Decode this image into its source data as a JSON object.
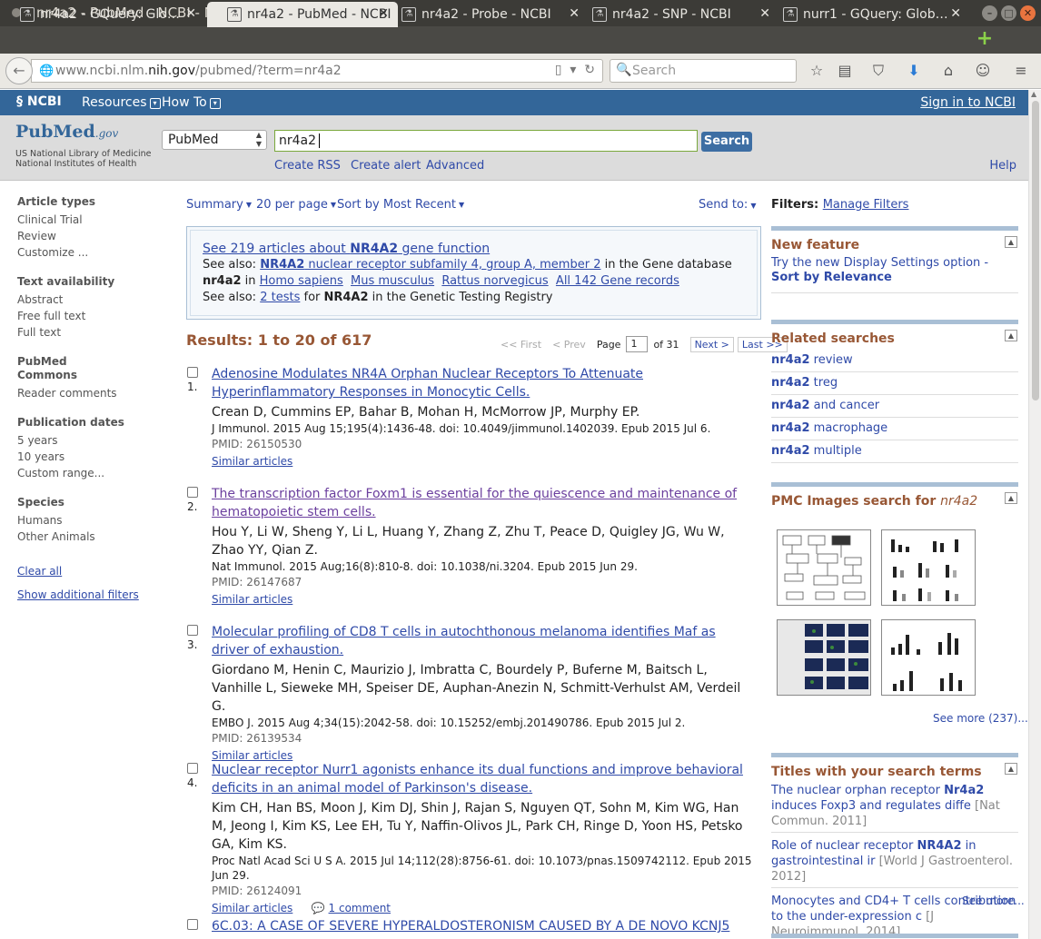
{
  "window": {
    "title": "nr4a2 - PubMed - NCBI - Mozilla Firefox"
  },
  "tabs": [
    {
      "label": "nr4a2 - GQuery: Glo…"
    },
    {
      "label": "nr4a2 - PubMed - NCBI"
    },
    {
      "label": "nr4a2 - Probe - NCBI"
    },
    {
      "label": "nr4a2 - SNP - NCBI"
    },
    {
      "label": "nurr1 - GQuery: Glob…"
    }
  ],
  "url": {
    "prefix": "www.ncbi.nlm.",
    "host": "nih.gov",
    "path": "/pubmed/?term=nr4a2"
  },
  "browser_search": {
    "placeholder": "Search"
  },
  "ncbi": {
    "logo": "NCBI",
    "resources": "Resources",
    "howto": "How To",
    "signin": "Sign in to NCBI"
  },
  "pubmed": {
    "logo_pub": "Pub",
    "logo_med": "Med",
    "logo_gov": ".gov",
    "sub1": "US National Library of Medicine",
    "sub2": "National Institutes of Health",
    "db": "PubMed",
    "query": "nr4a2",
    "search_btn": "Search",
    "create_rss": "Create RSS",
    "create_alert": "Create alert",
    "advanced": "Advanced",
    "help": "Help"
  },
  "leftnav": {
    "article_types": "Article types",
    "clinical_trial": "Clinical Trial",
    "review": "Review",
    "customize": "Customize ...",
    "text_availability": "Text availability",
    "abstract": "Abstract",
    "free_full_text": "Free full text",
    "full_text": "Full text",
    "pubmed_commons": "PubMed Commons",
    "reader_comments": "Reader comments",
    "pub_dates": "Publication dates",
    "five_years": "5 years",
    "ten_years": "10 years",
    "custom_range": "Custom range...",
    "species": "Species",
    "humans": "Humans",
    "other_animals": "Other Animals",
    "clear_all": "Clear all",
    "show_filters": "Show additional filters"
  },
  "controls": {
    "summary": "Summary",
    "per_page": "20 per page",
    "sort": "Sort by Most Recent",
    "send_to": "Send to:"
  },
  "see_all": {
    "line1_a": "See 219 articles about ",
    "line1_b": "NR4A2",
    "line1_c": " gene function",
    "see_also": "See also: ",
    "gene_link_b": "NR4A2",
    "gene_link": " nuclear receptor subfamily 4, group A, member 2",
    "gene_db": " in the Gene database",
    "nr4a2": "nr4a2",
    "in": " in ",
    "homo": "Homo sapiens",
    "mus": "Mus musculus",
    "rattus": "Rattus norvegicus",
    "all142": "All 142 Gene records",
    "tests": "2 tests",
    "for": " for ",
    "nr4a2_caps": "NR4A2",
    "gtr": " in the Genetic Testing Registry"
  },
  "results": {
    "header": "Results: 1 to 20 of 617"
  },
  "pager": {
    "first": "<< First",
    "prev": "< Prev",
    "page": "Page",
    "page_num": "1",
    "of": "of 31",
    "next": "Next >",
    "last": "Last >>"
  },
  "articles": [
    {
      "num": "1.",
      "title": "Adenosine Modulates NR4A Orphan Nuclear Receptors To Attenuate Hyperinflammatory Responses in Monocytic Cells.",
      "authors": "Crean D, Cummins EP, Bahar B, Mohan H, McMorrow JP, Murphy EP.",
      "journal": "J Immunol. 2015 Aug 15;195(4):1436-48. doi: 10.4049/jimmunol.1402039. Epub 2015 Jul 6.",
      "pmid": "PMID: 26150530",
      "similar": "Similar articles"
    },
    {
      "num": "2.",
      "title": "The transcription factor Foxm1 is essential for the quiescence and maintenance of hematopoietic stem cells.",
      "authors": "Hou Y, Li W, Sheng Y, Li L, Huang Y, Zhang Z, Zhu T, Peace D, Quigley JG, Wu W, Zhao YY, Qian Z.",
      "journal": "Nat Immunol. 2015 Aug;16(8):810-8. doi: 10.1038/ni.3204. Epub 2015 Jun 29.",
      "pmid": "PMID: 26147687",
      "similar": "Similar articles"
    },
    {
      "num": "3.",
      "title": "Molecular profiling of CD8 T cells in autochthonous melanoma identifies Maf as driver of exhaustion.",
      "authors": "Giordano M, Henin C, Maurizio J, Imbratta C, Bourdely P, Buferne M, Baitsch L, Vanhille L, Sieweke MH, Speiser DE, Auphan-Anezin N, Schmitt-Verhulst AM, Verdeil G.",
      "journal": "EMBO J. 2015 Aug 4;34(15):2042-58. doi: 10.15252/embj.201490786. Epub 2015 Jul 2.",
      "pmid": "PMID: 26139534",
      "similar": "Similar articles"
    },
    {
      "num": "4.",
      "title": "Nuclear receptor Nurr1 agonists enhance its dual functions and improve behavioral deficits in an animal model of Parkinson's disease.",
      "authors": "Kim CH, Han BS, Moon J, Kim DJ, Shin J, Rajan S, Nguyen QT, Sohn M, Kim WG, Han M, Jeong I, Kim KS, Lee EH, Tu Y, Naffin-Olivos JL, Park CH, Ringe D, Yoon HS, Petsko GA, Kim KS.",
      "journal": "Proc Natl Acad Sci U S A. 2015 Jul 14;112(28):8756-61. doi: 10.1073/pnas.1509742112. Epub 2015 Jun 29.",
      "pmid": "PMID: 26124091",
      "similar": "Similar articles",
      "comment": "1 comment"
    },
    {
      "num": "",
      "title": "6C.03: A CASE OF SEVERE HYPERALDOSTERONISM CAUSED BY A DE NOVO KCNJ5"
    }
  ],
  "right": {
    "filters_label": "Filters: ",
    "manage_filters": "Manage Filters",
    "new_feature_title": "New feature",
    "new_feature_text": "Try the new Display Settings option -",
    "new_feature_link": "Sort by Relevance",
    "related_title": "Related searches",
    "related": [
      {
        "b": "nr4a2",
        "t": " review"
      },
      {
        "b": "nr4a2",
        "t": " treg"
      },
      {
        "b": "nr4a2",
        "t": " and cancer"
      },
      {
        "b": "nr4a2",
        "t": " macrophage"
      },
      {
        "b": "nr4a2",
        "t": " multiple"
      }
    ],
    "pmc_title": "PMC Images search for ",
    "pmc_term": "nr4a2",
    "pmc_seemore": "See more (237)...",
    "titles_title": "Titles with your search terms",
    "titles": [
      {
        "a": "The nuclear orphan receptor ",
        "b": "Nr4a2",
        "c": " induces Foxp3 and regulates diffe",
        "src": "[Nat Commun. 2011]"
      },
      {
        "a": "Role of nuclear receptor ",
        "b": "NR4A2",
        "c": " in gastrointestinal ir",
        "src": "[World J Gastroenterol. 2012]"
      },
      {
        "a": "Monocytes and CD4+ T cells contribution to the under-expression c",
        "b": "",
        "c": "",
        "src": "[J Neuroimmunol. 2014]"
      }
    ],
    "titles_seemore": "See more..."
  }
}
